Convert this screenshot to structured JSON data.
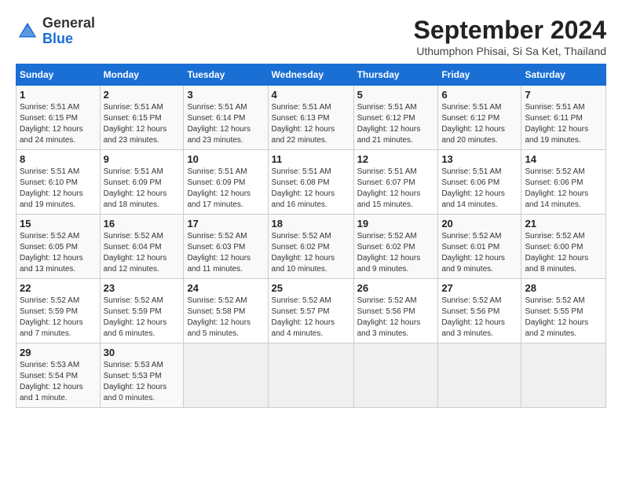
{
  "logo": {
    "text_general": "General",
    "text_blue": "Blue"
  },
  "header": {
    "month_title": "September 2024",
    "location": "Uthumphon Phisai, Si Sa Ket, Thailand"
  },
  "weekdays": [
    "Sunday",
    "Monday",
    "Tuesday",
    "Wednesday",
    "Thursday",
    "Friday",
    "Saturday"
  ],
  "weeks": [
    [
      {
        "day": "1",
        "sunrise": "5:51 AM",
        "sunset": "6:15 PM",
        "daylight": "12 hours and 24 minutes."
      },
      {
        "day": "2",
        "sunrise": "5:51 AM",
        "sunset": "6:15 PM",
        "daylight": "12 hours and 23 minutes."
      },
      {
        "day": "3",
        "sunrise": "5:51 AM",
        "sunset": "6:14 PM",
        "daylight": "12 hours and 23 minutes."
      },
      {
        "day": "4",
        "sunrise": "5:51 AM",
        "sunset": "6:13 PM",
        "daylight": "12 hours and 22 minutes."
      },
      {
        "day": "5",
        "sunrise": "5:51 AM",
        "sunset": "6:12 PM",
        "daylight": "12 hours and 21 minutes."
      },
      {
        "day": "6",
        "sunrise": "5:51 AM",
        "sunset": "6:12 PM",
        "daylight": "12 hours and 20 minutes."
      },
      {
        "day": "7",
        "sunrise": "5:51 AM",
        "sunset": "6:11 PM",
        "daylight": "12 hours and 19 minutes."
      }
    ],
    [
      {
        "day": "8",
        "sunrise": "5:51 AM",
        "sunset": "6:10 PM",
        "daylight": "12 hours and 19 minutes."
      },
      {
        "day": "9",
        "sunrise": "5:51 AM",
        "sunset": "6:09 PM",
        "daylight": "12 hours and 18 minutes."
      },
      {
        "day": "10",
        "sunrise": "5:51 AM",
        "sunset": "6:09 PM",
        "daylight": "12 hours and 17 minutes."
      },
      {
        "day": "11",
        "sunrise": "5:51 AM",
        "sunset": "6:08 PM",
        "daylight": "12 hours and 16 minutes."
      },
      {
        "day": "12",
        "sunrise": "5:51 AM",
        "sunset": "6:07 PM",
        "daylight": "12 hours and 15 minutes."
      },
      {
        "day": "13",
        "sunrise": "5:51 AM",
        "sunset": "6:06 PM",
        "daylight": "12 hours and 14 minutes."
      },
      {
        "day": "14",
        "sunrise": "5:52 AM",
        "sunset": "6:06 PM",
        "daylight": "12 hours and 14 minutes."
      }
    ],
    [
      {
        "day": "15",
        "sunrise": "5:52 AM",
        "sunset": "6:05 PM",
        "daylight": "12 hours and 13 minutes."
      },
      {
        "day": "16",
        "sunrise": "5:52 AM",
        "sunset": "6:04 PM",
        "daylight": "12 hours and 12 minutes."
      },
      {
        "day": "17",
        "sunrise": "5:52 AM",
        "sunset": "6:03 PM",
        "daylight": "12 hours and 11 minutes."
      },
      {
        "day": "18",
        "sunrise": "5:52 AM",
        "sunset": "6:02 PM",
        "daylight": "12 hours and 10 minutes."
      },
      {
        "day": "19",
        "sunrise": "5:52 AM",
        "sunset": "6:02 PM",
        "daylight": "12 hours and 9 minutes."
      },
      {
        "day": "20",
        "sunrise": "5:52 AM",
        "sunset": "6:01 PM",
        "daylight": "12 hours and 9 minutes."
      },
      {
        "day": "21",
        "sunrise": "5:52 AM",
        "sunset": "6:00 PM",
        "daylight": "12 hours and 8 minutes."
      }
    ],
    [
      {
        "day": "22",
        "sunrise": "5:52 AM",
        "sunset": "5:59 PM",
        "daylight": "12 hours and 7 minutes."
      },
      {
        "day": "23",
        "sunrise": "5:52 AM",
        "sunset": "5:59 PM",
        "daylight": "12 hours and 6 minutes."
      },
      {
        "day": "24",
        "sunrise": "5:52 AM",
        "sunset": "5:58 PM",
        "daylight": "12 hours and 5 minutes."
      },
      {
        "day": "25",
        "sunrise": "5:52 AM",
        "sunset": "5:57 PM",
        "daylight": "12 hours and 4 minutes."
      },
      {
        "day": "26",
        "sunrise": "5:52 AM",
        "sunset": "5:56 PM",
        "daylight": "12 hours and 3 minutes."
      },
      {
        "day": "27",
        "sunrise": "5:52 AM",
        "sunset": "5:56 PM",
        "daylight": "12 hours and 3 minutes."
      },
      {
        "day": "28",
        "sunrise": "5:52 AM",
        "sunset": "5:55 PM",
        "daylight": "12 hours and 2 minutes."
      }
    ],
    [
      {
        "day": "29",
        "sunrise": "5:53 AM",
        "sunset": "5:54 PM",
        "daylight": "12 hours and 1 minute."
      },
      {
        "day": "30",
        "sunrise": "5:53 AM",
        "sunset": "5:53 PM",
        "daylight": "12 hours and 0 minutes."
      },
      null,
      null,
      null,
      null,
      null
    ]
  ]
}
